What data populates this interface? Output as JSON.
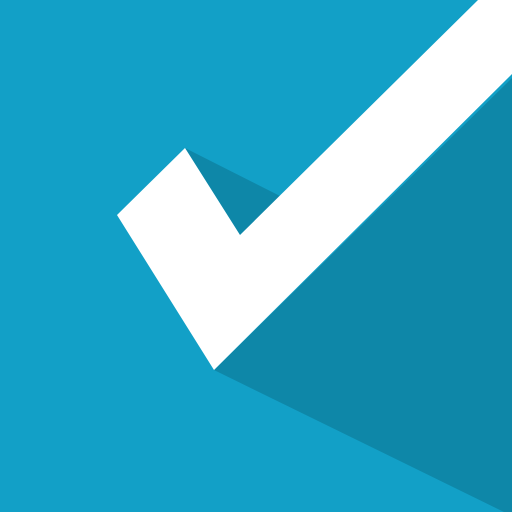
{
  "icon": {
    "name": "checkmark-icon",
    "colors": {
      "background": "#12A0C7",
      "shadow": "#0E87A8",
      "checkmark": "#FFFFFF"
    }
  }
}
